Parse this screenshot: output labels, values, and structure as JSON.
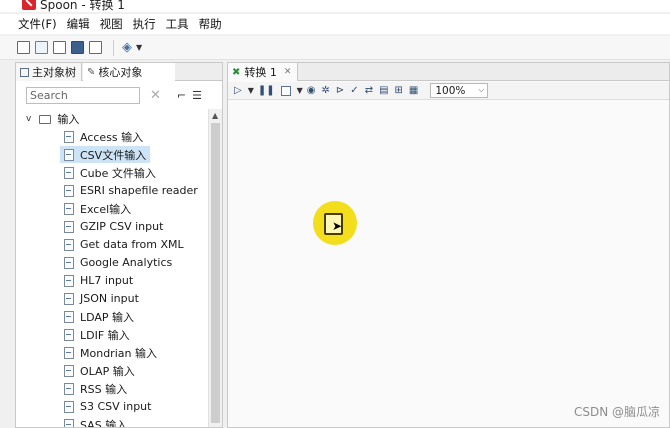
{
  "window": {
    "title": "Spoon - 转换 1"
  },
  "menu": [
    "文件(F)",
    "编辑",
    "视图",
    "执行",
    "工具",
    "帮助"
  ],
  "left_panel": {
    "tabs": [
      "主对象树",
      "核心对象"
    ],
    "search": {
      "placeholder": "Search",
      "value": ""
    },
    "folder": {
      "label": "输入",
      "expanded": true
    },
    "items": [
      "Access 输入",
      "CSV文件输入",
      "Cube 文件输入",
      "ESRI shapefile reader",
      "Excel输入",
      "GZIP CSV input",
      "Get data from XML",
      "Google Analytics",
      "HL7 input",
      "JSON input",
      "LDAP 输入",
      "LDIF 输入",
      "Mondrian 输入",
      "OLAP 输入",
      "RSS 输入",
      "S3 CSV input",
      "SAS 输入"
    ],
    "selected_item": "CSV文件输入"
  },
  "editor": {
    "tab": {
      "label": "转换 1"
    },
    "zoom": "100%"
  },
  "watermark": "CSDN @脑瓜凉",
  "colors": {
    "selection": "#cde4f7",
    "highlight": "#f2de1c",
    "transform_icon": "#2e8b3a"
  }
}
